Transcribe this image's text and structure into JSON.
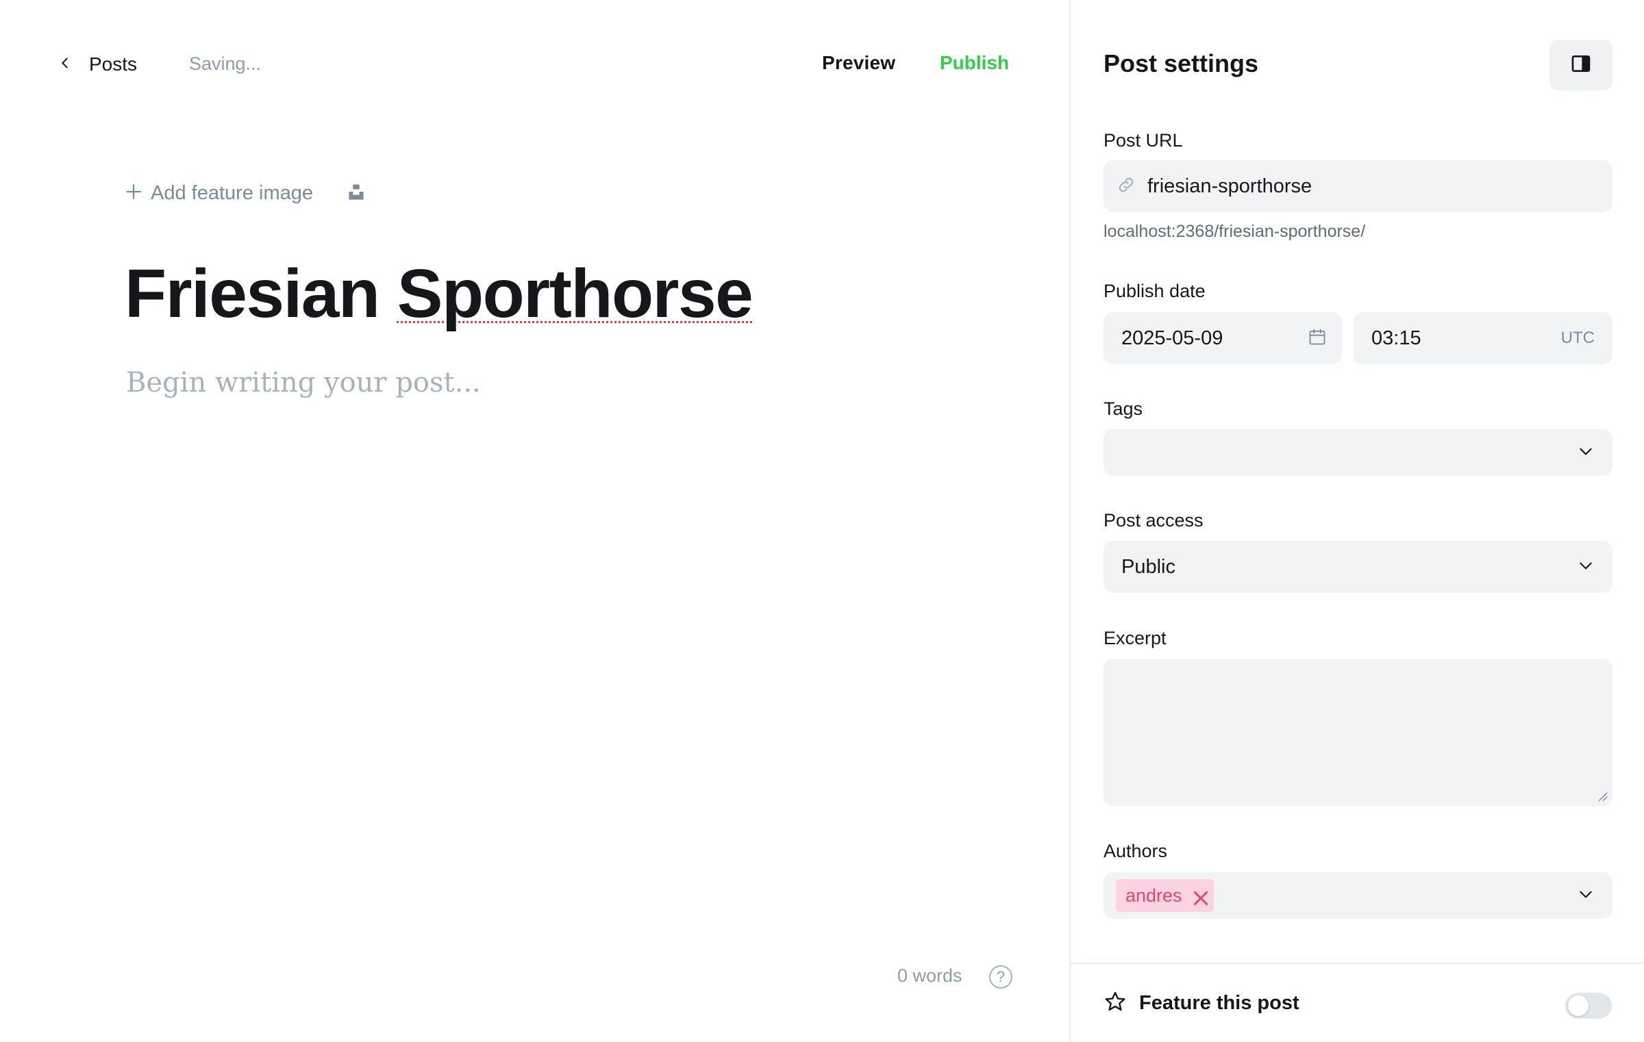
{
  "editor": {
    "back_label": "Posts",
    "status": "Saving...",
    "preview_label": "Preview",
    "publish_label": "Publish",
    "add_feature_image_label": "Add feature image",
    "title_first": "Friesian",
    "title_second": "Sporthorse",
    "body_placeholder": "Begin writing your post...",
    "word_count": "0 words",
    "help_label": "?"
  },
  "settings": {
    "title": "Post settings",
    "post_url_label": "Post URL",
    "post_url_value": "friesian-sporthorse",
    "post_url_hint": "localhost:2368/friesian-sporthorse/",
    "publish_date_label": "Publish date",
    "date_value": "2025-05-09",
    "time_value": "03:15",
    "timezone": "UTC",
    "tags_label": "Tags",
    "post_access_label": "Post access",
    "post_access_value": "Public",
    "excerpt_label": "Excerpt",
    "authors_label": "Authors",
    "authors": [
      "andres"
    ],
    "feature_post_label": "Feature this post",
    "feature_post_enabled": false
  },
  "colors": {
    "publish": "#30cf43",
    "author_chip_bg": "#fbd3e1",
    "author_chip_text": "#e0457b",
    "field_bg": "#f1f3f4"
  }
}
